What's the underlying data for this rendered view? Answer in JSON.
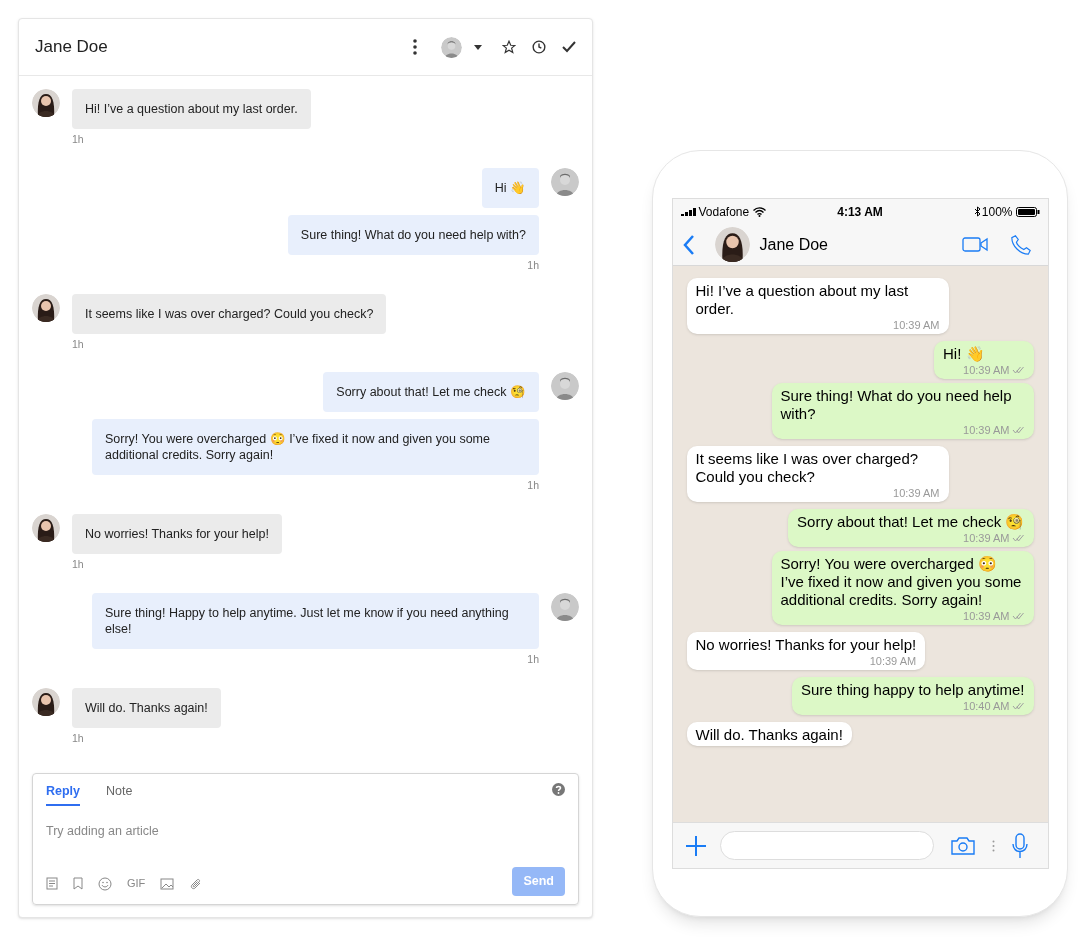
{
  "desk": {
    "title": "Jane Doe",
    "messages": [
      {
        "kind": "customer",
        "text": "Hi! I’ve a question about my last order.",
        "time": "1h"
      },
      {
        "kind": "agent",
        "text": "Hi 👋"
      },
      {
        "kind": "agent",
        "text": "Sure thing! What do you need help with?",
        "time": "1h"
      },
      {
        "kind": "customer",
        "text": "It seems like I was over charged? Could you check?",
        "time": "1h"
      },
      {
        "kind": "agent",
        "text": "Sorry about that! Let me check 🧐"
      },
      {
        "kind": "agent",
        "text": "Sorry! You were overcharged 😳 I’ve fixed it now and given you some additional credits. Sorry again!",
        "time": "1h"
      },
      {
        "kind": "customer",
        "text": "No worries! Thanks for your help!",
        "time": "1h"
      },
      {
        "kind": "agent",
        "text": "Sure thing! Happy to help anytime. Just let me know if you need anything else!",
        "time": "1h"
      },
      {
        "kind": "customer",
        "text": "Will do. Thanks again!",
        "time": "1h"
      }
    ],
    "composer": {
      "tabs": [
        {
          "label": "Reply",
          "selected": true
        },
        {
          "label": "Note",
          "selected": false
        }
      ],
      "placeholder": "Try adding an article",
      "gif": "GIF",
      "send": "Send"
    }
  },
  "phone": {
    "status": {
      "carrier": "Vodafone",
      "time": "4:13 AM",
      "battery": "100%"
    },
    "contact": "Jane Doe",
    "messages": [
      {
        "kind": "incoming",
        "text": "Hi! I’ve a question about my last order.",
        "time": "10:39 AM"
      },
      {
        "kind": "outgoing",
        "text": "Hi! 👋",
        "time": "10:39 AM"
      },
      {
        "kind": "outgoing",
        "text": "Sure thing! What do you need help with?",
        "time": "10:39 AM"
      },
      {
        "kind": "incoming",
        "text": "It seems like I was over charged? Could you check?",
        "time": "10:39 AM"
      },
      {
        "kind": "outgoing",
        "text": "Sorry about that! Let me check 🧐",
        "time": "10:39 AM"
      },
      {
        "kind": "outgoing",
        "text": "Sorry! You were overcharged 😳 I’ve fixed it now and given you some additional credits. Sorry again!",
        "time": "10:39 AM"
      },
      {
        "kind": "incoming",
        "text": "No worries! Thanks for your help!",
        "time": "10:39 AM"
      },
      {
        "kind": "outgoing",
        "text": "Sure thing happy to help anytime!",
        "time": "10:40 AM"
      },
      {
        "kind": "incoming",
        "text": "Will do. Thanks again!"
      }
    ]
  }
}
